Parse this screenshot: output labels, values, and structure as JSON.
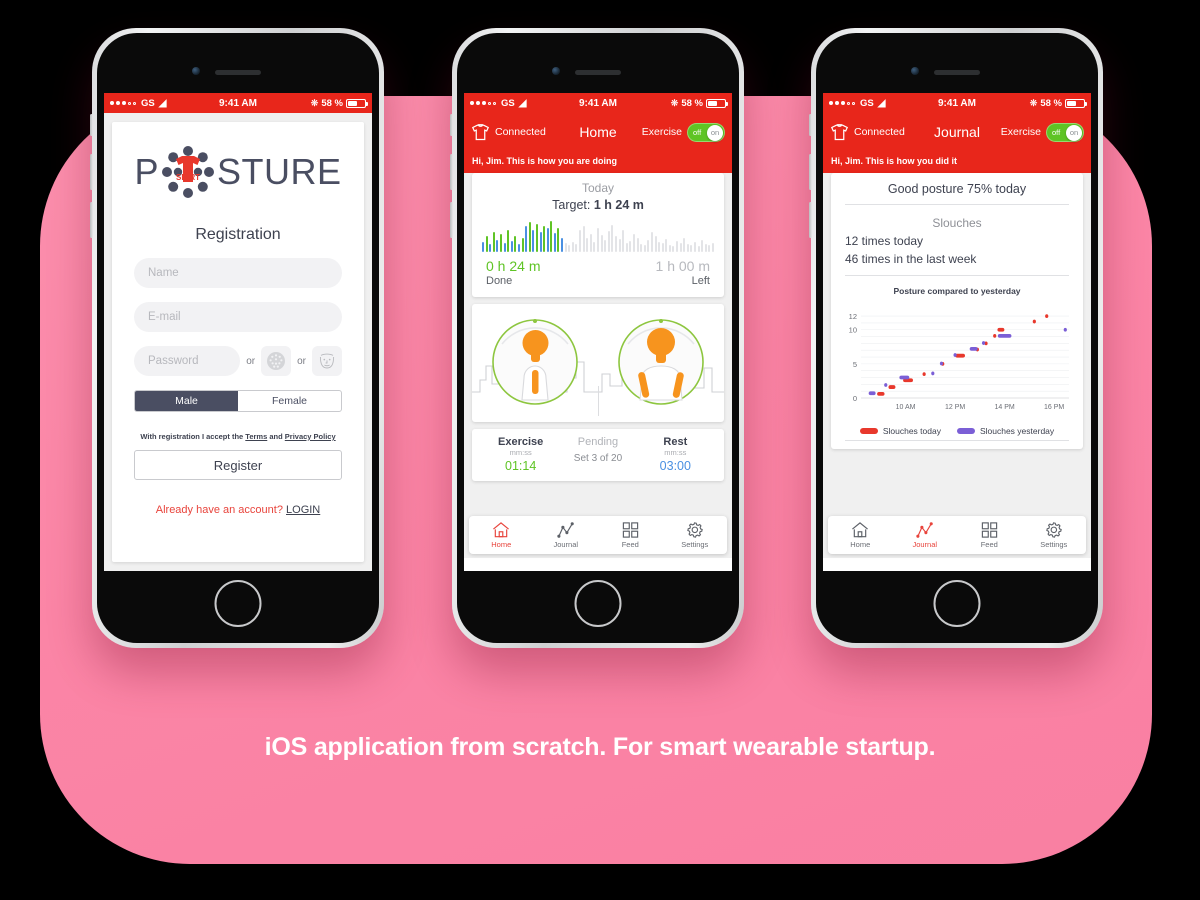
{
  "caption": "iOS application from scratch. For smart wearable startup.",
  "colors": {
    "brand_red": "#e8261b",
    "accent_red": "#e8443c",
    "pink_bg": "#fb85a6",
    "green": "#5fc425",
    "blue": "#4a90e2",
    "purple": "#7b5fd6",
    "dark_navy": "#4a4e62"
  },
  "status_bar": {
    "carrier": "GS",
    "time": "9:41 AM",
    "battery_text": "58 %",
    "signal_dots_filled": 3,
    "signal_dots_total": 5,
    "wifi_icon": "wifi-icon",
    "bluetooth_icon": "bluetooth-icon",
    "battery_icon": "battery-icon"
  },
  "phone1": {
    "logo": {
      "left_letter": "P",
      "right_letters": "STURE",
      "shirt_label": "SHIRT",
      "icon": "tshirt-dots-logo"
    },
    "title": "Registration",
    "fields": [
      {
        "name": "name-field",
        "placeholder": "Name",
        "value": ""
      },
      {
        "name": "email-field",
        "placeholder": "E-mail",
        "value": ""
      }
    ],
    "password": {
      "placeholder": "Password",
      "value": ""
    },
    "or_label_1": "or",
    "or_label_2": "or",
    "touch_id_icon": "fingerprint-icon",
    "face_id_icon": "face-id-icon",
    "gender": {
      "options": [
        "Male",
        "Female"
      ],
      "selected": "Male"
    },
    "terms": {
      "prefix": "With registration I accept the ",
      "terms_link": "Terms",
      "middle": " and ",
      "privacy_link": "Privacy Policy"
    },
    "register_button": "Register",
    "login_prompt": "Already have an account? ",
    "login_link": "LOGIN"
  },
  "phone2": {
    "nav": {
      "shirt_icon": "tshirt-icon",
      "connected": "Connected",
      "title": "Home",
      "exercise_label": "Exercise",
      "toggle_off": "off",
      "toggle_on": "on",
      "toggle_state": "on"
    },
    "greeting": "Hi, Jim. This is how you are doing",
    "today_card": {
      "title": "Today",
      "target_label": "Target:",
      "target_value": "1 h 24 m",
      "done_value": "0 h 24 m",
      "done_label": "Done",
      "left_value": "1 h 00 m",
      "left_label": "Left"
    },
    "exercise_card": {
      "illustration_left": "posture-sitting-good-icon",
      "illustration_right": "posture-arms-raised-icon"
    },
    "timer_card": {
      "exercise_label": "Exercise",
      "exercise_unit": "mm:ss",
      "exercise_value": "01:14",
      "pending_label": "Pending",
      "pending_value": "Set 3 of 20",
      "rest_label": "Rest",
      "rest_unit": "mm:ss",
      "rest_value": "03:00"
    },
    "tabs": [
      {
        "label": "Home",
        "icon": "home-icon",
        "active": true
      },
      {
        "label": "Journal",
        "icon": "chart-line-icon",
        "active": false
      },
      {
        "label": "Feed",
        "icon": "grid-icon",
        "active": false
      },
      {
        "label": "Settings",
        "icon": "gear-icon",
        "active": false
      }
    ]
  },
  "phone3": {
    "nav": {
      "shirt_icon": "tshirt-icon",
      "connected": "Connected",
      "title": "Journal",
      "exercise_label": "Exercise",
      "toggle_off": "off",
      "toggle_on": "on",
      "toggle_state": "on"
    },
    "greeting": "Hi, Jim. This is how you did it",
    "headline": "Good posture 75% today",
    "slouches_title": "Slouches",
    "slouches_today": "12 times today",
    "slouches_week": "46 times in the last week",
    "tabs": [
      {
        "label": "Home",
        "icon": "home-icon",
        "active": false
      },
      {
        "label": "Journal",
        "icon": "chart-line-icon",
        "active": true
      },
      {
        "label": "Feed",
        "icon": "grid-icon",
        "active": false
      },
      {
        "label": "Settings",
        "icon": "gear-icon",
        "active": false
      }
    ]
  },
  "chart_data": {
    "type": "scatter",
    "title": "Posture compared to yesterday",
    "xlabel": "",
    "ylabel": "",
    "xlim": [
      8.2,
      16.6
    ],
    "ylim": [
      0,
      12.6
    ],
    "yticks": [
      0,
      5,
      10,
      12
    ],
    "ytick_labels": [
      "0",
      "5",
      "10",
      "12"
    ],
    "xticks": [
      10,
      12,
      14,
      16
    ],
    "xtick_labels": [
      "10 AM",
      "12 PM",
      "14 PM",
      "16 PM"
    ],
    "grid": true,
    "legend_position": "bottom",
    "series": [
      {
        "name": "Slouches today",
        "color": "#e8382c",
        "points": [
          {
            "x": 9.0,
            "y": 0.6,
            "w": 0.3
          },
          {
            "x": 9.45,
            "y": 1.6,
            "w": 0.28
          },
          {
            "x": 10.1,
            "y": 2.6,
            "w": 0.4
          },
          {
            "x": 10.75,
            "y": 3.5,
            "w": 0.1
          },
          {
            "x": 11.5,
            "y": 5.0,
            "w": 0.1
          },
          {
            "x": 12.2,
            "y": 6.2,
            "w": 0.4
          },
          {
            "x": 12.9,
            "y": 7.1,
            "w": 0.1
          },
          {
            "x": 13.25,
            "y": 8.0,
            "w": 0.1
          },
          {
            "x": 13.6,
            "y": 9.1,
            "w": 0.12
          },
          {
            "x": 13.85,
            "y": 10.0,
            "w": 0.28
          },
          {
            "x": 15.2,
            "y": 11.2,
            "w": 0.1
          },
          {
            "x": 15.7,
            "y": 12.0,
            "w": 0.1
          }
        ]
      },
      {
        "name": "Slouches yesterday",
        "color": "#7b5fd6",
        "points": [
          {
            "x": 8.65,
            "y": 0.7,
            "w": 0.28
          },
          {
            "x": 9.2,
            "y": 1.9,
            "w": 0.1
          },
          {
            "x": 9.95,
            "y": 3.0,
            "w": 0.4
          },
          {
            "x": 11.1,
            "y": 3.6,
            "w": 0.1
          },
          {
            "x": 11.45,
            "y": 5.05,
            "w": 0.1
          },
          {
            "x": 12.0,
            "y": 6.3,
            "w": 0.1
          },
          {
            "x": 12.75,
            "y": 7.2,
            "w": 0.32
          },
          {
            "x": 13.15,
            "y": 8.05,
            "w": 0.1
          },
          {
            "x": 14.0,
            "y": 9.1,
            "w": 0.55
          },
          {
            "x": 16.45,
            "y": 10.0,
            "w": 0.1
          }
        ]
      }
    ]
  }
}
